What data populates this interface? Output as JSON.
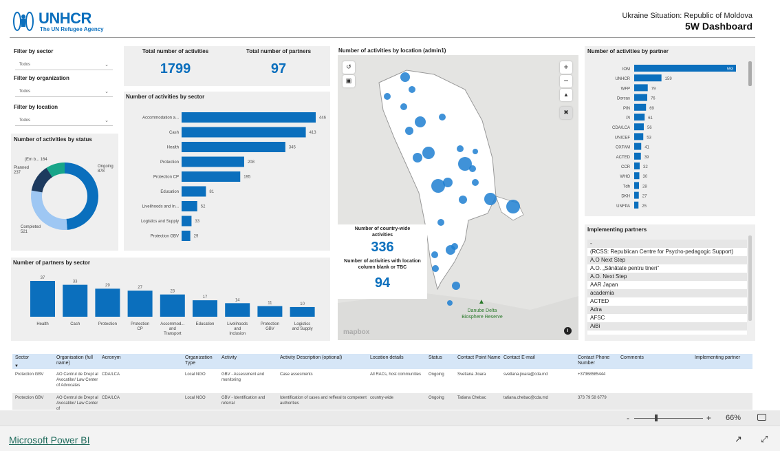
{
  "header": {
    "logo_text": "UNHCR",
    "logo_subtitle": "The UN Refugee Agency",
    "subtitle": "Ukraine Situation: Republic of Moldova",
    "title": "5W Dashboard"
  },
  "filters": {
    "sector_label": "Filter by sector",
    "sector_value": "Todos",
    "organization_label": "Filter by organization",
    "organization_value": "Todos",
    "location_label": "Filter by location",
    "location_value": "Todos"
  },
  "kpis": {
    "activities_label": "Total number of activities",
    "activities_value": "1799",
    "partners_label": "Total number of partners",
    "partners_value": "97"
  },
  "status_chart": {
    "title": "Number of activities by status",
    "labels": [
      {
        "name": "Ongoing",
        "value": "878"
      },
      {
        "name": "Completed",
        "value": "521"
      },
      {
        "name": "Planned",
        "value": "237"
      },
      {
        "name": "(Em b...",
        "value": "164"
      }
    ]
  },
  "sector_chart_title": "Number of activities by sector",
  "partner_sector_chart_title": "Number of partners by sector",
  "partner_chart_title": "Number of activities by partner",
  "map": {
    "title": "Number of activities by location (admin1)",
    "countrywide_label": "Number of country-wide activities",
    "countrywide_value": "336",
    "blank_label": "Number of activities with location column blank or TBC",
    "blank_value": "94",
    "place_label": "Danube Delta Biosphere Reserve",
    "watermark": "mapbox"
  },
  "implementing": {
    "title": "Implementing partners",
    "items": [
      "-",
      "(RCSS: Republican Centre for Psycho-pedagogic Support)",
      "A.O Next Step",
      "A.O. „Sănătate pentru tineri”",
      "A.O. Next Step",
      "AAR Japan",
      "academia",
      "ACTED",
      "Adra",
      "AFSC",
      "AiBi"
    ]
  },
  "table": {
    "headers": [
      "Sector",
      "Organisation (full name)",
      "Acronym",
      "Organization Type",
      "Activity",
      "Activity Description (optional)",
      "Location details",
      "Status",
      "Contact Point Name",
      "Contact E-mail",
      "Contact Phone Number",
      "Comments",
      "Implementing partner"
    ],
    "rows": [
      [
        "Protection GBV",
        "AO Centrul de Drept al Avocatilor/ Law Center of Advocates",
        "CDA/LCA",
        "Local NGO",
        "GBV - Assessment and monitoring",
        "Case assesments",
        "All RACs, host communities",
        "Ongoing",
        "Svetlana Jioara",
        "svetlana.jioara@cda.md",
        "+37368585444",
        "",
        ""
      ],
      [
        "Protection GBV",
        "AO Centrul de Drept al Avocatilor/ Law Center of",
        "CDA/LCA",
        "Local NGO",
        "GBV - Identification and referral",
        "Identification of cases and refferal to competent authorities",
        "country-wide",
        "Ongoing",
        "Tatiana Chebac",
        "tatiana.chebac@cda.md",
        "373 79 58 6779",
        "",
        ""
      ]
    ]
  },
  "footer": {
    "zoom_minus": "-",
    "zoom_plus": "+",
    "zoom_level": "66%",
    "brand_link": "Microsoft Power BI"
  },
  "colors": {
    "accent": "#0b6fbd",
    "ongoing": "#0a6fbd",
    "completed": "#9ec7f3",
    "planned": "#1d3a5e",
    "emb": "#17a589",
    "panel": "#efefef"
  },
  "chart_data": [
    {
      "type": "pie",
      "title": "Number of activities by status",
      "categories": [
        "Ongoing",
        "Completed",
        "Planned",
        "(Em b..."
      ],
      "values": [
        878,
        521,
        237,
        164
      ]
    },
    {
      "type": "bar",
      "title": "Number of activities by sector",
      "categories": [
        "Accommodation a...",
        "Cash",
        "Health",
        "Protection",
        "Protection CP",
        "Education",
        "Livelihoods and In...",
        "Logistics and Supply",
        "Protection GBV"
      ],
      "values": [
        446,
        413,
        345,
        208,
        195,
        81,
        52,
        33,
        29
      ]
    },
    {
      "type": "bar",
      "title": "Number of partners by sector",
      "categories": [
        "Health",
        "Cash",
        "Protection",
        "Protection CP",
        "Accommod... and Transport",
        "Education",
        "Livelihoods and Inclusion",
        "Protection GBV",
        "Logistics and Supply"
      ],
      "values": [
        37,
        33,
        29,
        27,
        23,
        17,
        14,
        11,
        10
      ]
    },
    {
      "type": "bar",
      "title": "Number of activities by partner",
      "categories": [
        "IOM",
        "UNHCR",
        "WFP",
        "Dorcas",
        "PIN",
        "PI",
        "CDA/LCA",
        "UNICEF",
        "OXFAM",
        "ACTED",
        "CCR",
        "WHO",
        "Tdh",
        "DKH",
        "UNFPA"
      ],
      "values": [
        593,
        159,
        79,
        76,
        69,
        61,
        56,
        53,
        41,
        39,
        32,
        30,
        28,
        27,
        25
      ]
    }
  ]
}
